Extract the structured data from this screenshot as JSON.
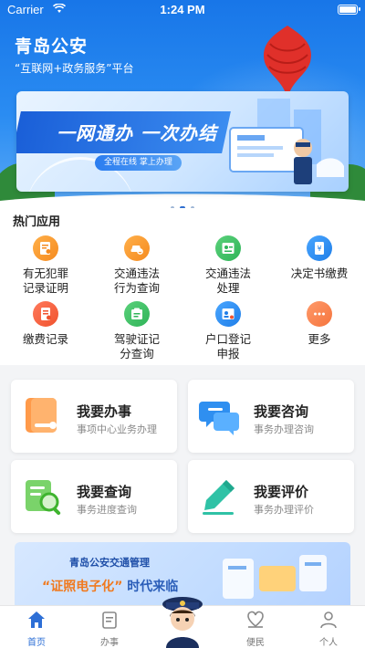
{
  "status": {
    "carrier": "Carrier",
    "time": "1:24 PM"
  },
  "header": {
    "title": "青岛公安",
    "subtitle": "“互联网+政务服务”平台"
  },
  "banner": {
    "slogan": "一网通办 一次办结",
    "pill": "全程在线  掌上办理"
  },
  "hot": {
    "title": "热门应用",
    "items": [
      {
        "label": "有无犯罪\n记录证明",
        "icon": "certificate-icon",
        "color": "orange"
      },
      {
        "label": "交通违法\n行为查询",
        "icon": "car-search-icon",
        "color": "orange"
      },
      {
        "label": "交通违法\n处理",
        "icon": "ticket-icon",
        "color": "green"
      },
      {
        "label": "决定书缴费",
        "icon": "document-pay-icon",
        "color": "blue"
      },
      {
        "label": "缴费记录",
        "icon": "payment-record-icon",
        "color": "red"
      },
      {
        "label": "驾驶证记\n分查询",
        "icon": "license-icon",
        "color": "green"
      },
      {
        "label": "户口登记\n申报",
        "icon": "household-icon",
        "color": "blue"
      },
      {
        "label": "更多",
        "icon": "more-icon",
        "color": "orange"
      }
    ]
  },
  "cards": [
    {
      "title": "我要办事",
      "desc": "事项中心业务办理",
      "icon": "apply-icon"
    },
    {
      "title": "我要咨询",
      "desc": "事务办理咨询",
      "icon": "chat-icon"
    },
    {
      "title": "我要查询",
      "desc": "事务进度查询",
      "icon": "search-doc-icon"
    },
    {
      "title": "我要评价",
      "desc": "事务办理评价",
      "icon": "edit-icon"
    }
  ],
  "promo": {
    "line1": "青岛公安交通管理",
    "line2_hl": "“证照电子化”",
    "line2_rest": "时代来临"
  },
  "tabs": [
    {
      "label": "首页",
      "icon": "home-icon",
      "active": true
    },
    {
      "label": "办事",
      "icon": "affairs-icon",
      "active": false
    },
    {
      "label": "",
      "icon": "officer-icon",
      "active": false
    },
    {
      "label": "便民",
      "icon": "service-icon",
      "active": false
    },
    {
      "label": "个人",
      "icon": "user-icon",
      "active": false
    }
  ],
  "colors": {
    "accent": "#2d6fd6",
    "header": "#1876e8"
  }
}
